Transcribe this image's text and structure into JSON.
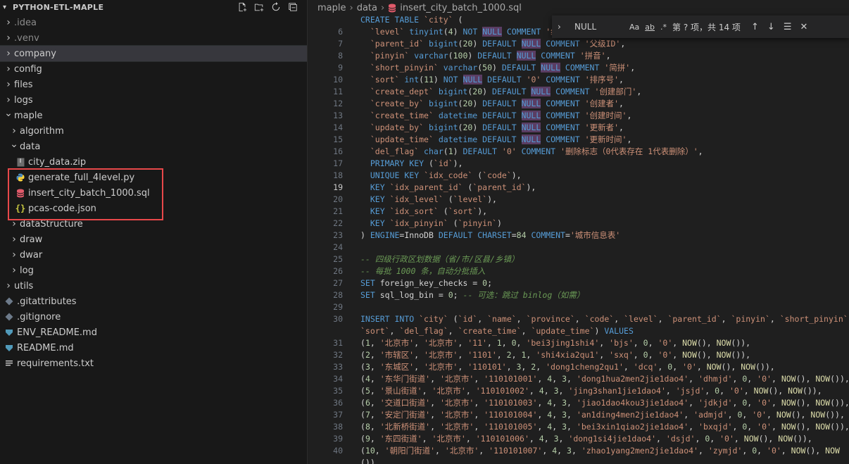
{
  "explorer": {
    "title": "PYTHON-ETL-MAPLE",
    "items": [
      {
        "label": ".idea",
        "icon": "chevron-right",
        "depth": 0,
        "type": "folder",
        "dim": true
      },
      {
        "label": ".venv",
        "icon": "chevron-right",
        "depth": 0,
        "type": "folder",
        "dim": true
      },
      {
        "label": "company",
        "icon": "chevron-right",
        "depth": 0,
        "type": "folder",
        "selected": true
      },
      {
        "label": "config",
        "icon": "chevron-right",
        "depth": 0,
        "type": "folder"
      },
      {
        "label": "files",
        "icon": "chevron-right",
        "depth": 0,
        "type": "folder"
      },
      {
        "label": "logs",
        "icon": "chevron-right",
        "depth": 0,
        "type": "folder"
      },
      {
        "label": "maple",
        "icon": "chevron-down",
        "depth": 0,
        "type": "folder"
      },
      {
        "label": "algorithm",
        "icon": "chevron-right",
        "depth": 1,
        "type": "folder"
      },
      {
        "label": "data",
        "icon": "chevron-down",
        "depth": 1,
        "type": "folder"
      },
      {
        "label": "city_data.zip",
        "icon": "zip-file-icon",
        "depth": 2,
        "type": "file"
      },
      {
        "label": "generate_full_4level.py",
        "icon": "python-file-icon",
        "depth": 2,
        "type": "file"
      },
      {
        "label": "insert_city_batch_1000.sql",
        "icon": "database-file-icon",
        "depth": 2,
        "type": "file"
      },
      {
        "label": "pcas-code.json",
        "icon": "json-file-icon",
        "depth": 2,
        "type": "file"
      },
      {
        "label": "dataStructure",
        "icon": "chevron-right",
        "depth": 1,
        "type": "folder"
      },
      {
        "label": "draw",
        "icon": "chevron-right",
        "depth": 1,
        "type": "folder"
      },
      {
        "label": "dwar",
        "icon": "chevron-right",
        "depth": 1,
        "type": "folder"
      },
      {
        "label": "log",
        "icon": "chevron-right",
        "depth": 1,
        "type": "folder"
      },
      {
        "label": "utils",
        "icon": "chevron-right",
        "depth": 0,
        "type": "folder"
      },
      {
        "label": ".gitattributes",
        "icon": "git-file-icon",
        "depth": 0,
        "type": "file"
      },
      {
        "label": ".gitignore",
        "icon": "git-file-icon",
        "depth": 0,
        "type": "file"
      },
      {
        "label": "ENV_README.md",
        "icon": "markdown-file-icon",
        "depth": 0,
        "type": "file"
      },
      {
        "label": "README.md",
        "icon": "markdown-file-icon",
        "depth": 0,
        "type": "file"
      },
      {
        "label": "requirements.txt",
        "icon": "text-file-icon",
        "depth": 0,
        "type": "file"
      }
    ]
  },
  "breadcrumb": {
    "parts": [
      "maple",
      "data",
      "insert_city_batch_1000.sql"
    ]
  },
  "find": {
    "query": "NULL",
    "match_case": "Aa",
    "whole_word": "ab",
    "regex": ".*",
    "count": "第 ? 项，共 14 项"
  },
  "code": {
    "active_line": "19",
    "lines": [
      {
        "n": "",
        "t": "CREATE TABLE `city` ("
      },
      {
        "n": "6",
        "t": "  `level` tinyint(4) NOT NULL COMMENT '级别'"
      },
      {
        "n": "7",
        "t": "  `parent_id` bigint(20) DEFAULT NULL COMMENT '父级ID',"
      },
      {
        "n": "8",
        "t": "  `pinyin` varchar(100) DEFAULT NULL COMMENT '拼音',"
      },
      {
        "n": "9",
        "t": "  `short_pinyin` varchar(50) DEFAULT NULL COMMENT '简拼',"
      },
      {
        "n": "10",
        "t": "  `sort` int(11) NOT NULL DEFAULT '0' COMMENT '排序号',"
      },
      {
        "n": "11",
        "t": "  `create_dept` bigint(20) DEFAULT NULL COMMENT '创建部门',"
      },
      {
        "n": "12",
        "t": "  `create_by` bigint(20) DEFAULT NULL COMMENT '创建者',"
      },
      {
        "n": "13",
        "t": "  `create_time` datetime DEFAULT NULL COMMENT '创建时间',"
      },
      {
        "n": "14",
        "t": "  `update_by` bigint(20) DEFAULT NULL COMMENT '更新者',"
      },
      {
        "n": "15",
        "t": "  `update_time` datetime DEFAULT NULL COMMENT '更新时间',"
      },
      {
        "n": "16",
        "t": "  `del_flag` char(1) DEFAULT '0' COMMENT '删除标志（0代表存在 1代表删除）',"
      },
      {
        "n": "17",
        "t": "  PRIMARY KEY (`id`),"
      },
      {
        "n": "18",
        "t": "  UNIQUE KEY `idx_code` (`code`),"
      },
      {
        "n": "19",
        "t": "  KEY `idx_parent_id` (`parent_id`),"
      },
      {
        "n": "20",
        "t": "  KEY `idx_level` (`level`),"
      },
      {
        "n": "21",
        "t": "  KEY `idx_sort` (`sort`),"
      },
      {
        "n": "22",
        "t": "  KEY `idx_pinyin` (`pinyin`)"
      },
      {
        "n": "23",
        "t": ") ENGINE=InnoDB DEFAULT CHARSET=utf8mb4 COMMENT='城市信息表'"
      },
      {
        "n": "24",
        "t": ""
      },
      {
        "n": "25",
        "t": "-- 四级行政区划数据（省/市/区县/乡镇）"
      },
      {
        "n": "26",
        "t": "-- 每批 1000 条，自动分批插入"
      },
      {
        "n": "27",
        "t": "SET foreign_key_checks = 0;"
      },
      {
        "n": "28",
        "t": "SET sql_log_bin = 0; -- 可选：跳过 binlog（如需）"
      },
      {
        "n": "29",
        "t": ""
      },
      {
        "n": "30",
        "t": "INSERT INTO `city` (`id`, `name`, `province`, `code`, `level`, `parent_id`, `pinyin`, `short_pinyin`,"
      },
      {
        "n": "",
        "t": "`sort`, `del_flag`, `create_time`, `update_time`) VALUES"
      },
      {
        "n": "31",
        "t": "(1, '北京市', '北京市', '11', 1, 0, 'bei3jing1shi4', 'bjs', 0, '0', NOW(), NOW()),"
      },
      {
        "n": "32",
        "t": "(2, '市辖区', '北京市', '1101', 2, 1, 'shi4xia2qu1', 'sxq', 0, '0', NOW(), NOW()),"
      },
      {
        "n": "33",
        "t": "(3, '东城区', '北京市', '110101', 3, 2, 'dong1cheng2qu1', 'dcq', 0, '0', NOW(), NOW()),"
      },
      {
        "n": "34",
        "t": "(4, '东华门街道', '北京市', '110101001', 4, 3, 'dong1hua2men2jie1dao4', 'dhmjd', 0, '0', NOW(), NOW()),"
      },
      {
        "n": "35",
        "t": "(5, '景山街道', '北京市', '110101002', 4, 3, 'jing3shan1jie1dao4', 'jsjd', 0, '0', NOW(), NOW()),"
      },
      {
        "n": "36",
        "t": "(6, '交道口街道', '北京市', '110101003', 4, 3, 'jiao1dao4kou3jie1dao4', 'jdkjd', 0, '0', NOW(), NOW()),"
      },
      {
        "n": "37",
        "t": "(7, '安定门街道', '北京市', '110101004', 4, 3, 'an1ding4men2jie1dao4', 'admjd', 0, '0', NOW(), NOW()),"
      },
      {
        "n": "38",
        "t": "(8, '北新桥街道', '北京市', '110101005', 4, 3, 'bei3xin1qiao2jie1dao4', 'bxqjd', 0, '0', NOW(), NOW()),"
      },
      {
        "n": "39",
        "t": "(9, '东四街道', '北京市', '110101006', 4, 3, 'dong1si4jie1dao4', 'dsjd', 0, '0', NOW(), NOW()),"
      },
      {
        "n": "40",
        "t": "(10, '朝阳门街道', '北京市', '110101007', 4, 3, 'zhao1yang2men2jie1dao4', 'zymjd', 0, '0', NOW(), NOW"
      },
      {
        "n": "",
        "t": "())"
      }
    ]
  }
}
